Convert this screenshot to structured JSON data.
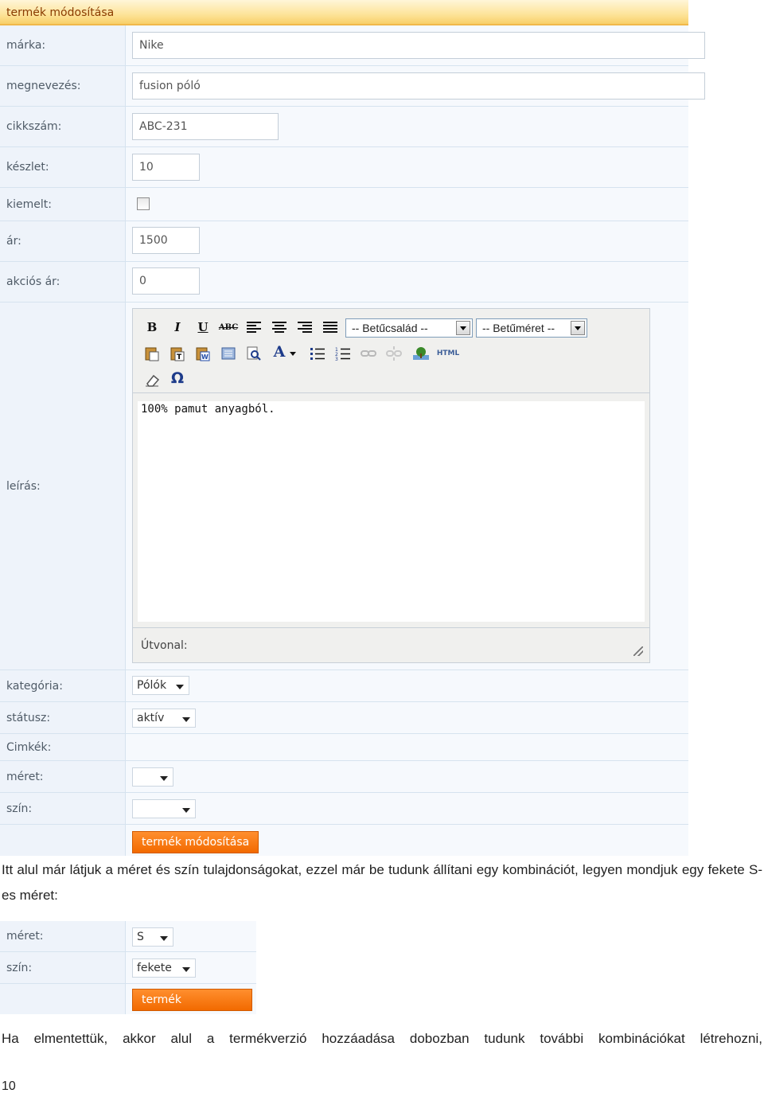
{
  "form": {
    "title": "termék módosítása",
    "fields": {
      "marka": {
        "label": "márka:",
        "value": "Nike"
      },
      "megnevezes": {
        "label": "megnevezés:",
        "value": "fusion póló"
      },
      "cikkszam": {
        "label": "cikkszám:",
        "value": "ABC-231"
      },
      "keszlet": {
        "label": "készlet:",
        "value": "10"
      },
      "kiemelt": {
        "label": "kiemelt:",
        "checked": false
      },
      "ar": {
        "label": "ár:",
        "value": "1500"
      },
      "akcios_ar": {
        "label": "akciós ár:",
        "value": "0"
      },
      "leiras": {
        "label": "leírás:"
      },
      "kategoria": {
        "label": "kategória:",
        "value": "Pólók"
      },
      "statusz": {
        "label": "státusz:",
        "value": "aktív"
      },
      "cimkek": {
        "label": "Cimkék:"
      },
      "meret": {
        "label": "méret:",
        "value": ""
      },
      "szin": {
        "label": "szín:",
        "value": ""
      }
    },
    "editor": {
      "font_family_placeholder": "-- Betűcsalád --",
      "font_size_placeholder": "-- Betűméret --",
      "content": "100% pamut anyagból.",
      "path_label": "Útvonal:",
      "html_button": "HTML",
      "bold": "B",
      "italic": "I",
      "underline": "U",
      "strike": "ABC",
      "omega": "Ω",
      "text_color": "A"
    },
    "submit_label": "termék módosítása"
  },
  "paragraph1": "Itt alul már látjuk a méret és szín tulajdonságokat, ezzel már be tudunk állítani egy kombinációt, legyen mondjuk egy fekete S-es méret:",
  "form2": {
    "meret": {
      "label": "méret:",
      "value": "S"
    },
    "szin": {
      "label": "szín:",
      "value": "fekete"
    },
    "submit_label": "termék módosítása"
  },
  "paragraph2": "Ha elmentettük, akkor alul a termékverzió hozzáadása dobozban tudunk további kombinációkat létrehozni,",
  "page_number": "10",
  "colors": {
    "accent_orange": "#f26a00",
    "header_yellow": "#fde49a",
    "label_bg": "#eef3fa"
  }
}
